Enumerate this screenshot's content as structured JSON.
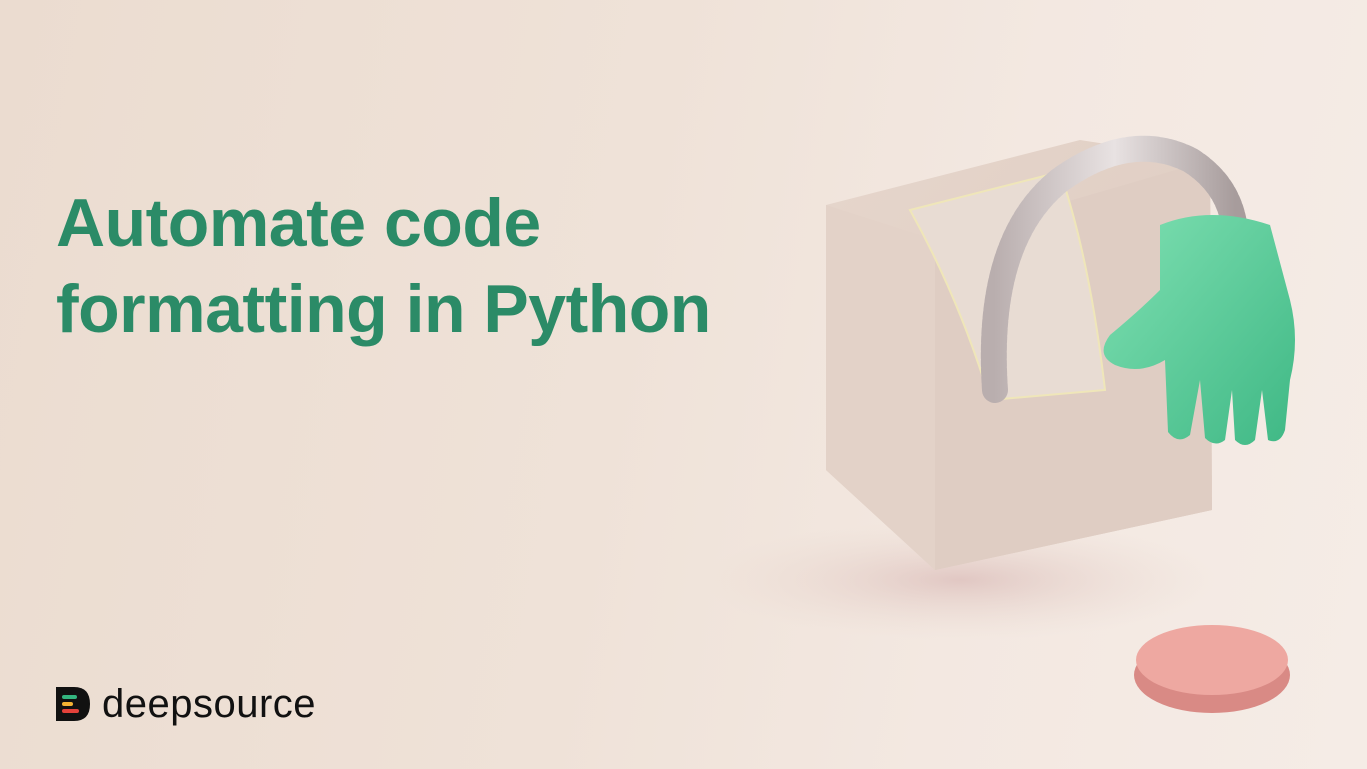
{
  "hero": {
    "title_lines": [
      "Automate code",
      "formatting in Python"
    ]
  },
  "brand": {
    "name": "deepsource",
    "logo_colors": [
      "#111111",
      "#33b57f",
      "#f2b233",
      "#e3413a"
    ]
  },
  "colors": {
    "title": "#2b8b67",
    "background": "#efe2d8",
    "glove": "#5fcf9b",
    "button": "#eb9c95"
  }
}
